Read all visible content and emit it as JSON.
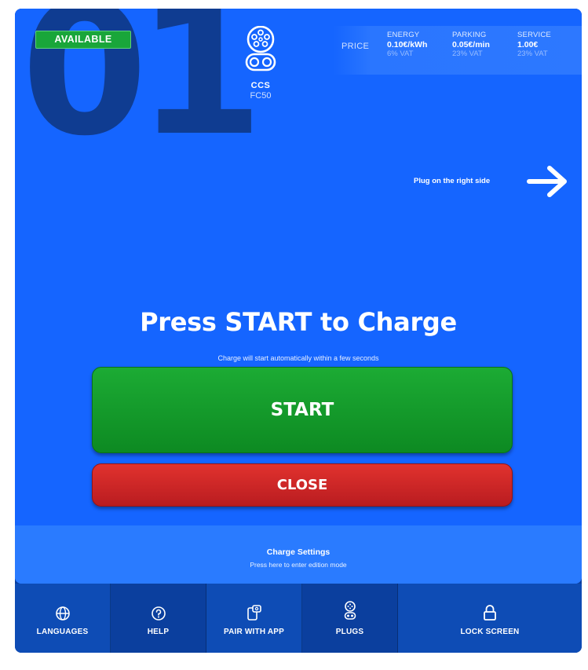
{
  "connector": {
    "number": "01",
    "status": "AVAILABLE",
    "plug_type": "CCS",
    "plug_model": "FC50",
    "plug_icon": "ccs-connector-icon"
  },
  "pricing": {
    "label": "PRICE",
    "columns": [
      {
        "header": "ENERGY",
        "value": "0.10€/kWh",
        "vat": "6% VAT"
      },
      {
        "header": "PARKING",
        "value": "0.05€/min",
        "vat": "23% VAT"
      },
      {
        "header": "SERVICE",
        "value": "1.00€",
        "vat": "23% VAT"
      }
    ]
  },
  "plug_side": {
    "text": "Plug on the right side",
    "icon": "arrow-right-icon"
  },
  "main": {
    "headline": "Press START to Charge",
    "subline": "Charge will start automatically within a few seconds",
    "start_label": "START",
    "close_label": "CLOSE"
  },
  "settings": {
    "title": "Charge Settings",
    "subtitle": "Press here to enter edition mode"
  },
  "nav": [
    {
      "label": "LANGUAGES",
      "icon": "globe-icon"
    },
    {
      "label": "HELP",
      "icon": "help-icon"
    },
    {
      "label": "PAIR WITH APP",
      "icon": "pair-app-icon"
    },
    {
      "label": "PLUGS",
      "icon": "plug-icon"
    },
    {
      "label": "LOCK SCREEN",
      "icon": "lock-icon"
    }
  ],
  "colors": {
    "screen_bg": "#1565ff",
    "frame_bg": "#0b3f9e",
    "available_badge": "#19a63a",
    "start_button": "#12962b",
    "close_button": "#cc2626"
  }
}
